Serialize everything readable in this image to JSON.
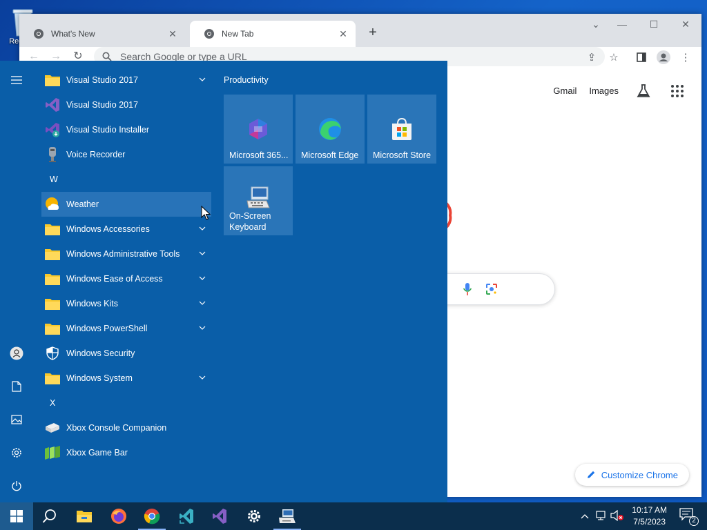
{
  "desktop": {
    "recycle_label": "Rec"
  },
  "chrome": {
    "tabs": [
      {
        "title": "What's New"
      },
      {
        "title": "New Tab"
      }
    ],
    "omnibox_placeholder": "Search Google or type a URL",
    "links": {
      "gmail": "Gmail",
      "images": "Images"
    },
    "customize_label": "Customize Chrome"
  },
  "start_menu": {
    "apps": [
      {
        "label": "Visual Studio 2017",
        "icon": "folder-icon",
        "expandable": true
      },
      {
        "label": "Visual Studio 2017",
        "icon": "visual-studio-icon",
        "expandable": false
      },
      {
        "label": "Visual Studio Installer",
        "icon": "vs-installer-icon",
        "expandable": false
      },
      {
        "label": "Voice Recorder",
        "icon": "microphone-icon",
        "expandable": false
      },
      {
        "letter": "W"
      },
      {
        "label": "Weather",
        "icon": "weather-icon",
        "expandable": false,
        "highlighted": true
      },
      {
        "label": "Windows Accessories",
        "icon": "folder-icon",
        "expandable": true
      },
      {
        "label": "Windows Administrative Tools",
        "icon": "folder-icon",
        "expandable": true
      },
      {
        "label": "Windows Ease of Access",
        "icon": "folder-icon",
        "expandable": true
      },
      {
        "label": "Windows Kits",
        "icon": "folder-icon",
        "expandable": true
      },
      {
        "label": "Windows PowerShell",
        "icon": "folder-icon",
        "expandable": true
      },
      {
        "label": "Windows Security",
        "icon": "shield-icon",
        "expandable": false
      },
      {
        "label": "Windows System",
        "icon": "folder-icon",
        "expandable": true
      },
      {
        "letter": "X"
      },
      {
        "label": "Xbox Console Companion",
        "icon": "xbox-console-icon",
        "expandable": false
      },
      {
        "label": "Xbox Game Bar",
        "icon": "xbox-gamebar-icon",
        "expandable": false
      }
    ],
    "tile_group": "Productivity",
    "tiles": [
      {
        "label": "Microsoft 365...",
        "icon": "microsoft-365-icon"
      },
      {
        "label": "Microsoft Edge",
        "icon": "edge-icon"
      },
      {
        "label": "Microsoft Store",
        "icon": "store-icon"
      },
      {
        "label": "On-Screen Keyboard",
        "icon": "keyboard-icon"
      }
    ]
  },
  "taskbar": {
    "time": "10:17 AM",
    "date": "7/5/2023",
    "notification_count": "2"
  },
  "colors": {
    "start_bg": "#0a5ea8",
    "tile_bg": "#2a75b8",
    "taskbar_bg": "#0b2e4c",
    "chrome_accent": "#1a73e8"
  }
}
